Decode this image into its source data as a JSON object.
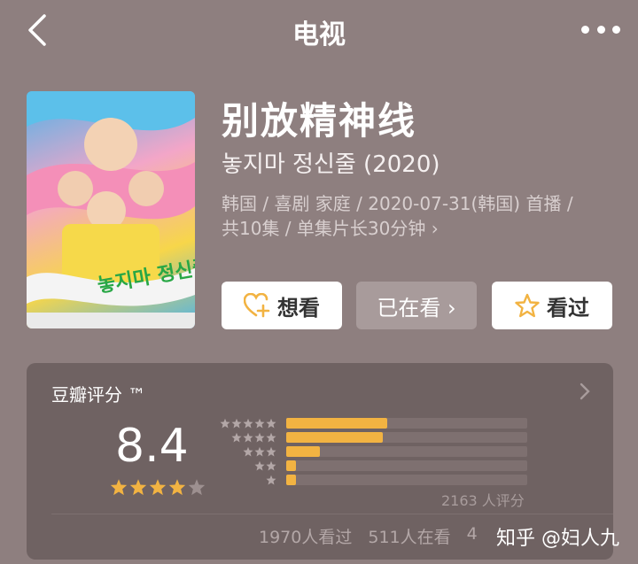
{
  "nav": {
    "title": "电视"
  },
  "show": {
    "title": "别放精神线",
    "original_title": "놓지마 정신줄 (2020)",
    "meta_line1": "韩国 / 喜剧 家庭 / 2020-07-31(韩国) 首播 /",
    "meta_line2": "共10集 / 单集片长30分钟 ›",
    "poster_text": "놓지마 정신줄!"
  },
  "actions": {
    "want": "想看",
    "watching": "已在看 ›",
    "watched": "看过"
  },
  "rating": {
    "label": "豆瓣评分 ™",
    "score": "8.4",
    "stars_filled": 4,
    "stars_total": 5,
    "count_text": "2163 人评分",
    "distribution": [
      {
        "stars": 5,
        "fraction": 0.42
      },
      {
        "stars": 4,
        "fraction": 0.4
      },
      {
        "stars": 3,
        "fraction": 0.14
      },
      {
        "stars": 2,
        "fraction": 0.04
      },
      {
        "stars": 1,
        "fraction": 0.04
      }
    ],
    "watched_text": "1970人看过",
    "watching_text": "511人在看",
    "want_text": "4"
  },
  "watermark": "知乎 @妇人九",
  "colors": {
    "accent": "#f2b342",
    "background": "#8e7f7f",
    "card": "#6f6262"
  }
}
